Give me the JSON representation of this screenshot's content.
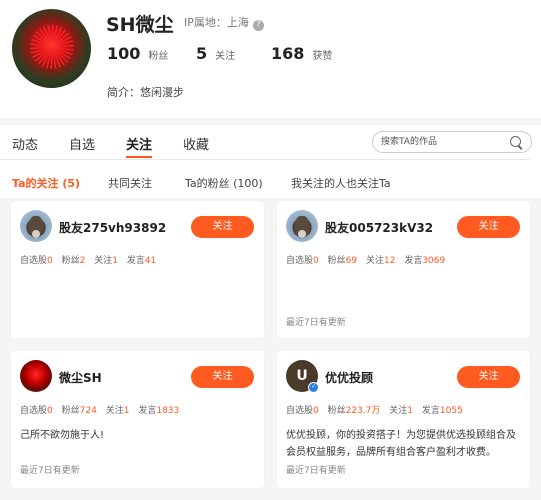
{
  "profile": {
    "username": "SH微尘",
    "ip_location": "IP属地：上海",
    "fans_count": "100",
    "fans_label": "粉丝",
    "following_count": "5",
    "following_label": "关注",
    "likes_count": "168",
    "likes_label": "获赞",
    "bio": "简介：悠闲漫步"
  },
  "tabs": [
    {
      "label": "动态",
      "active": false
    },
    {
      "label": "自选",
      "active": false
    },
    {
      "label": "关注",
      "active": true
    },
    {
      "label": "收藏",
      "active": false
    }
  ],
  "search": {
    "placeholder": "搜索TA的作品"
  },
  "subtabs": [
    {
      "label": "Ta的关注 (5)",
      "active": true
    },
    {
      "label": "共同关注",
      "active": false
    },
    {
      "label": "Ta的粉丝 (100)",
      "active": false
    },
    {
      "label": "我关注的人也关注Ta",
      "active": false
    }
  ],
  "cards": [
    {
      "name": "股友275vh93892",
      "follow_label": "关注",
      "stock_label": "自选股",
      "stock": "0",
      "fans_label": "粉丝",
      "fans": "2",
      "following_label": "关注",
      "following": "1",
      "posts_label": "发言",
      "posts": "41",
      "desc": "",
      "update": ""
    },
    {
      "name": "股友005723kV32",
      "follow_label": "关注",
      "stock_label": "自选股",
      "stock": "0",
      "fans_label": "粉丝",
      "fans": "69",
      "following_label": "关注",
      "following": "12",
      "posts_label": "发言",
      "posts": "3069",
      "desc": "",
      "update": "最近7日有更新"
    },
    {
      "name": "微尘SH",
      "follow_label": "关注",
      "stock_label": "自选股",
      "stock": "0",
      "fans_label": "粉丝",
      "fans": "724",
      "following_label": "关注",
      "following": "1",
      "posts_label": "发言",
      "posts": "1833",
      "desc": "己所不欲勿施于人!",
      "update": "最近7日有更新"
    },
    {
      "name": "优优投顾",
      "follow_label": "关注",
      "stock_label": "自选股",
      "stock": "0",
      "fans_label": "粉丝",
      "fans": "223.7万",
      "following_label": "关注",
      "following": "1",
      "posts_label": "发言",
      "posts": "1055",
      "desc": "优优投顾，你的投资搭子！为您提供优选投顾组合及会员权益服务，品牌所有组合客户盈利才收费。",
      "update": "最近7日有更新"
    }
  ],
  "colors": {
    "accent": "#ff5a1f",
    "verified": "#2e7be6"
  },
  "icons": [
    "help-icon",
    "search-icon",
    "verified-icon"
  ]
}
